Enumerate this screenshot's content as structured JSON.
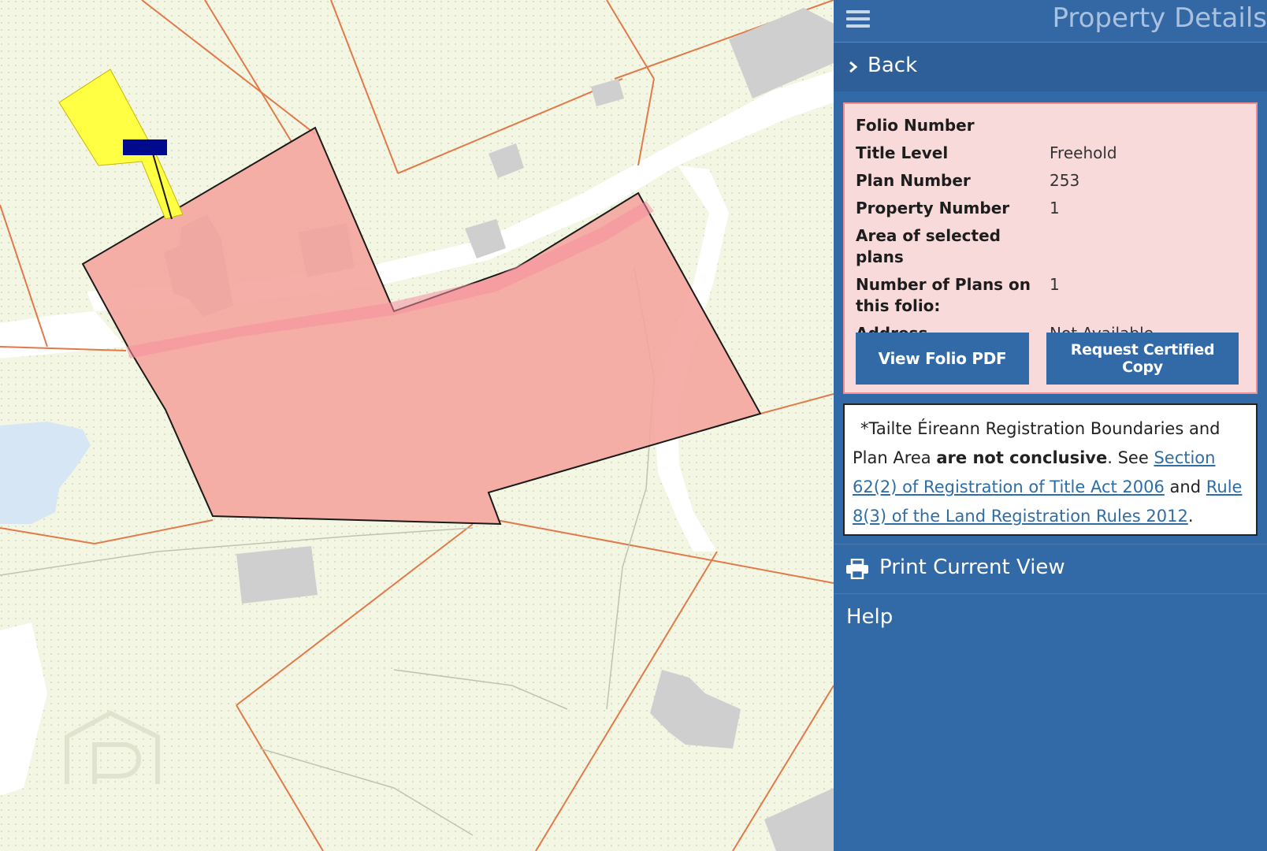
{
  "panel": {
    "title": "Property Details",
    "back_label": "Back",
    "menu_icon": "hamburger-menu-icon"
  },
  "details": {
    "rows": [
      {
        "label": "Folio Number",
        "value": ""
      },
      {
        "label": "Title Level",
        "value": "Freehold"
      },
      {
        "label": "Plan Number",
        "value": "253"
      },
      {
        "label": "Property Number",
        "value": "1"
      },
      {
        "label": "Area of selected plans",
        "value": ""
      },
      {
        "label_line1": "Number of Plans on",
        "label_line2": "this folio:",
        "value": "1"
      },
      {
        "label": "Address",
        "value": "Not Available"
      }
    ],
    "view_folio_label": "View Folio PDF",
    "request_copy_label": "Request Certified Copy"
  },
  "disclaimer": {
    "prefix": "*Tailte Éireann Registration Boundaries and Plan Area ",
    "bold": "are not conclusive",
    "see": ". See ",
    "link1": "Section 62(2) of Registration of Title Act 2006",
    "and": " and ",
    "link2": "Rule 8(3) of the Land Registration Rules 2012",
    "end": "."
  },
  "menu": {
    "print_label": "Print Current View",
    "help_label": "Help"
  },
  "map": {
    "colors": {
      "background": "#f3f6e2",
      "parcel_fill": "#f5a49c",
      "parcel_border": "#1a1a1a",
      "boundary_line": "#e07a4a",
      "building": "#cfcfcf",
      "road": "#ffffff",
      "water": "#d6e6f5",
      "highlight_yellow": "#ffff44",
      "marker_navy": "#000a8c"
    }
  }
}
